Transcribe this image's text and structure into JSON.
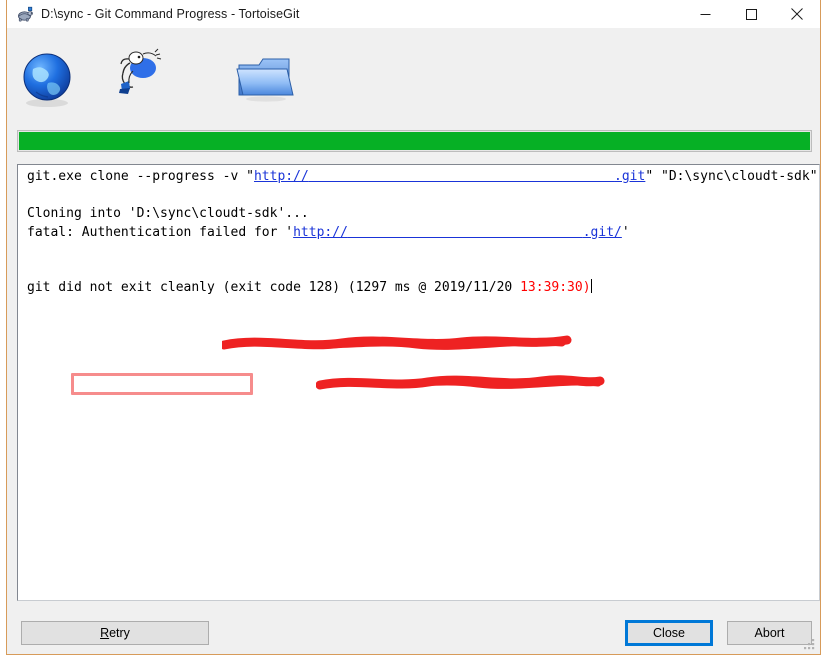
{
  "window": {
    "title": "D:\\sync - Git Command Progress - TortoiseGit",
    "app_icon": "tortoisegit-turtle-icon",
    "border_color": "#d79b5a",
    "controls": {
      "minimize": "minimize-icon",
      "maximize": "maximize-icon",
      "close": "close-icon"
    }
  },
  "toolbar": {
    "items": [
      {
        "name": "globe-icon",
        "label": "globe"
      },
      {
        "name": "running-figure-icon",
        "label": "animated running figure"
      },
      {
        "name": "folder-icon",
        "label": "folder"
      }
    ]
  },
  "progress": {
    "percent": 100,
    "fill_color": "#06b025"
  },
  "log": {
    "lines": [
      {
        "id": "command-line",
        "segments": [
          {
            "text": "git.exe clone --progress -v \"",
            "style": "plain"
          },
          {
            "text": "http://",
            "style": "link"
          },
          {
            "text": "                                       ",
            "style": "link-redacted"
          },
          {
            "text": ".git",
            "style": "link"
          },
          {
            "text": "\" \"D:\\sync\\cloudt-sdk\"",
            "style": "plain"
          }
        ]
      },
      {
        "id": "blank-1",
        "segments": []
      },
      {
        "id": "cloning-line",
        "segments": [
          {
            "text": "Cloning into 'D:\\sync\\cloudt-sdk'...",
            "style": "plain"
          }
        ]
      },
      {
        "id": "fatal-line",
        "segments": [
          {
            "text": "fatal: Authentication failed for '",
            "style": "plain"
          },
          {
            "text": "http://",
            "style": "link"
          },
          {
            "text": "                              ",
            "style": "link-redacted"
          },
          {
            "text": ".git/",
            "style": "link"
          },
          {
            "text": "'",
            "style": "plain"
          }
        ]
      },
      {
        "id": "blank-2",
        "segments": []
      },
      {
        "id": "blank-3",
        "segments": []
      },
      {
        "id": "exit-line",
        "segments": [
          {
            "text": "git did not exit cleanly (exit code 128) (1297 ms @ 2019/11/20 ",
            "style": "plain"
          },
          {
            "text": "13:39:30)",
            "style": "red"
          }
        ]
      }
    ],
    "exit_code": "128",
    "duration_ms": "1297",
    "timestamp_date": "2019/11/20",
    "timestamp_time": "13:39:30"
  },
  "annotations": {
    "red_color": "#ee2222",
    "scribble_command_url": "red freehand redaction over repository URL on command line",
    "scribble_fatal_url": "red freehand redaction over repository URL on fatal line",
    "highlight_box_label": "Authentication failed for"
  },
  "footer": {
    "retry": {
      "label": "Retry",
      "accel": "R"
    },
    "close": {
      "label": "Close",
      "focused": true
    },
    "abort": {
      "label": "Abort"
    }
  }
}
